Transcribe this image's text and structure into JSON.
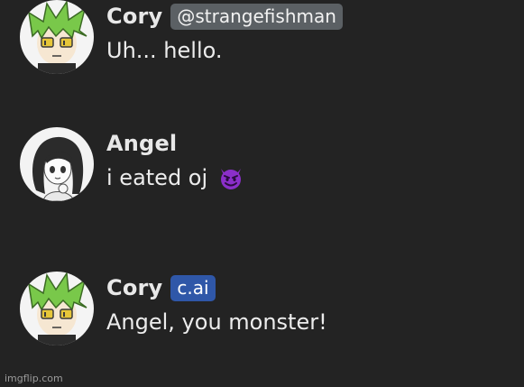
{
  "messages": [
    {
      "author": "Cory",
      "tag": "@strangefishman",
      "tag_type": "handle",
      "text": "Uh... hello.",
      "avatar_icon": "green-haired-boy-avatar"
    },
    {
      "author": "Angel",
      "tag": "",
      "text": "i eated oj",
      "emoji": "smiling-devil-emoji",
      "avatar_icon": "dark-haired-girl-avatar"
    },
    {
      "author": "Cory",
      "tag": "c.ai",
      "tag_type": "ai-badge",
      "text": "Angel, you monster!",
      "avatar_icon": "green-haired-boy-avatar"
    }
  ],
  "watermark": "imgflip.com",
  "colors": {
    "background": "#232323",
    "handle_tag": "#5b6064",
    "ai_tag": "#2f57a8",
    "emoji": "#8b2fc9"
  }
}
